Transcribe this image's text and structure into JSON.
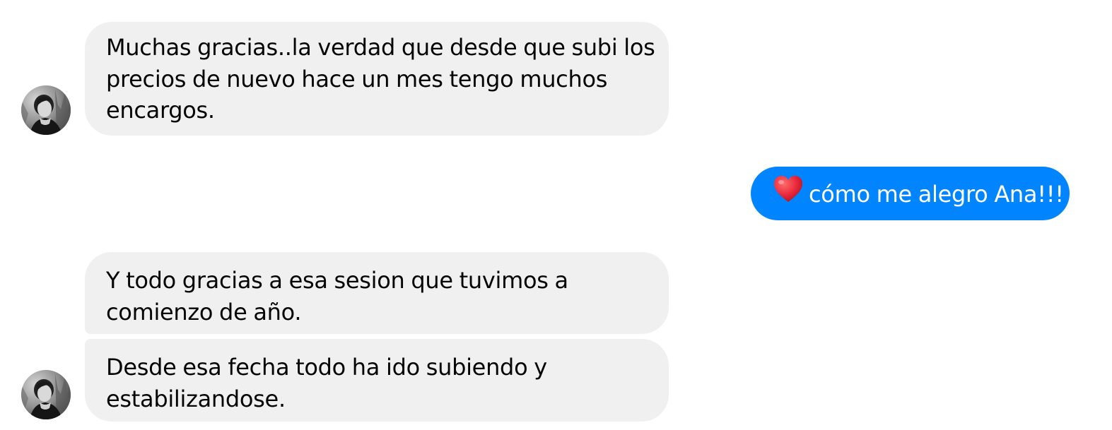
{
  "conversation": {
    "contact": {
      "avatar_icon": "contact-avatar-photo"
    },
    "messages": [
      {
        "sender": "contact",
        "lines": [
          "Muchas gracias..la verdad que desde que subi los",
          "precios de nuevo hace un mes tengo muchos",
          "encargos."
        ]
      },
      {
        "sender": "me",
        "emoji": "red-heart",
        "text": "cómo me alegro Ana!!!"
      },
      {
        "sender": "contact",
        "lines": [
          "Y todo gracias a esa sesion que tuvimos a",
          "comienzo de año."
        ]
      },
      {
        "sender": "contact",
        "lines": [
          "Desde esa fecha todo ha ido subiendo y",
          "estabilizandose."
        ]
      }
    ]
  },
  "colors": {
    "incoming_bubble": "#f0f0f0",
    "incoming_text": "#050505",
    "outgoing_bubble": "#0084ff",
    "outgoing_text": "#ffffff",
    "heart": "#e8283b"
  }
}
